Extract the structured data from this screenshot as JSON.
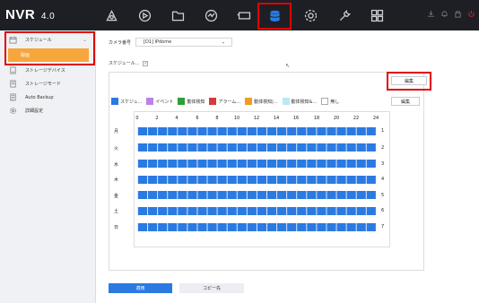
{
  "app": {
    "logo": "NVR",
    "version": "4.0"
  },
  "nav": {
    "icons": [
      {
        "name": "live-view-icon",
        "active": false
      },
      {
        "name": "playback-icon",
        "active": false
      },
      {
        "name": "file-management-icon",
        "active": false
      },
      {
        "name": "smart-analysis-icon",
        "active": false
      },
      {
        "name": "camera-icon",
        "active": false
      },
      {
        "name": "storage-icon",
        "active": true
      },
      {
        "name": "system-settings-icon",
        "active": false
      },
      {
        "name": "maintenance-icon",
        "active": false
      },
      {
        "name": "more-icon",
        "active": false
      }
    ],
    "right_icons": [
      "download-icon",
      "alarm-icon",
      "lock-icon",
      "power-icon"
    ],
    "highlight_color": "#e00000"
  },
  "sidebar": {
    "items": [
      {
        "label": "スケジュール",
        "icon": "calendar-icon",
        "expanded": true
      },
      {
        "label": "ストレージデバイス",
        "icon": "storage-device-icon"
      },
      {
        "label": "ストレージモード",
        "icon": "storage-mode-icon"
      },
      {
        "label": "Auto Backup",
        "icon": "backup-icon"
      },
      {
        "label": "詳細設定",
        "icon": "advanced-settings-icon"
      }
    ],
    "sub_item": {
      "label": "録画",
      "active": true
    }
  },
  "form": {
    "camera_label": "カメラ番号",
    "camera_value": "[D1] IPdome",
    "schedule_label": "スケジュール...",
    "schedule_checked": true
  },
  "buttons": {
    "edit_top": "編集",
    "edit": "編集",
    "apply": "適用",
    "copy": "コピー先"
  },
  "legend": [
    {
      "label": "スケジュ...",
      "color": "#2a7ae2"
    },
    {
      "label": "イベント",
      "color": "#b884e8"
    },
    {
      "label": "動体検知",
      "color": "#2e9e3b"
    },
    {
      "label": "アラーム...",
      "color": "#d8393b"
    },
    {
      "label": "動体検知|...",
      "color": "#f29c1f"
    },
    {
      "label": "動体検知&...",
      "color": "#bde7f5"
    },
    {
      "label": "無し",
      "color": "#ffffff"
    }
  ],
  "schedule": {
    "ticks": [
      "0",
      "2",
      "4",
      "6",
      "8",
      "10",
      "12",
      "14",
      "16",
      "18",
      "20",
      "22",
      "24"
    ],
    "days": [
      {
        "label": "月",
        "num": "1"
      },
      {
        "label": "火",
        "num": "2"
      },
      {
        "label": "水",
        "num": "3"
      },
      {
        "label": "木",
        "num": "4"
      },
      {
        "label": "金",
        "num": "5"
      },
      {
        "label": "土",
        "num": "6"
      },
      {
        "label": "日",
        "num": "7"
      }
    ],
    "bar_color": "#2a7ae2"
  }
}
